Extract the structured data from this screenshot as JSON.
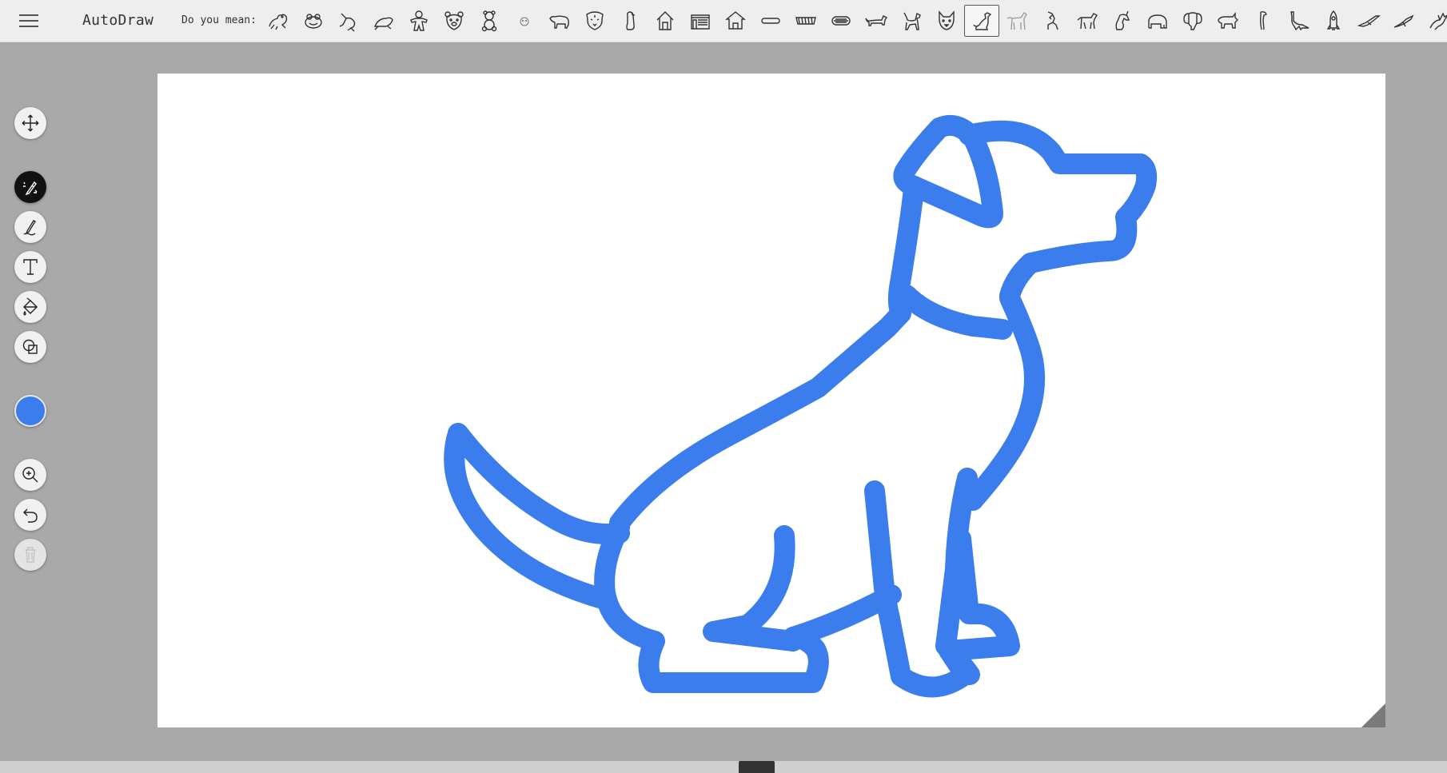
{
  "app": {
    "title": "AutoDraw",
    "menu_icon": "hamburger-icon"
  },
  "suggestions": {
    "label": "Do you mean:",
    "selected_index": 20,
    "items": [
      "frog",
      "frog-face",
      "frog-jumping",
      "frog-sitting",
      "gingerbread-man",
      "bear-face",
      "teddy-bear",
      "polar-bear-face",
      "bear-walking",
      "tiger-face",
      "penguin",
      "house",
      "building",
      "house-front",
      "hot-dog",
      "sandwich",
      "burger",
      "dachshund",
      "dog-standing",
      "dog-face",
      "dog-sitting",
      "horse",
      "horse-rearing",
      "horse-walking",
      "unicorn",
      "elephant",
      "elephant-face",
      "rhino",
      "giraffe-head",
      "dinosaur",
      "rocket",
      "bird-flying",
      "bird-gliding",
      "dragon"
    ]
  },
  "tools": {
    "select": {
      "icon": "move-arrows-icon",
      "tooltip": "Select"
    },
    "autodraw": {
      "icon": "autodraw-magic-pencil-icon",
      "tooltip": "AutoDraw"
    },
    "draw": {
      "icon": "pencil-icon",
      "tooltip": "Draw"
    },
    "type": {
      "icon": "text-icon",
      "tooltip": "Type"
    },
    "fill": {
      "icon": "paint-bucket-icon",
      "tooltip": "Fill"
    },
    "shape": {
      "icon": "shapes-icon",
      "tooltip": "Shape"
    },
    "zoom": {
      "icon": "zoom-in-icon",
      "tooltip": "Zoom"
    },
    "undo": {
      "icon": "undo-icon",
      "tooltip": "Undo"
    },
    "delete": {
      "icon": "trash-icon",
      "tooltip": "Delete"
    }
  },
  "colors": {
    "current": "#3b7ded",
    "drawing_stroke": "#3b7ded",
    "active_tool_bg": "#111111",
    "canvas_bg": "#ffffff",
    "workspace_bg": "#a9a9a9"
  },
  "canvas": {
    "drawing": "dog-sitting"
  }
}
